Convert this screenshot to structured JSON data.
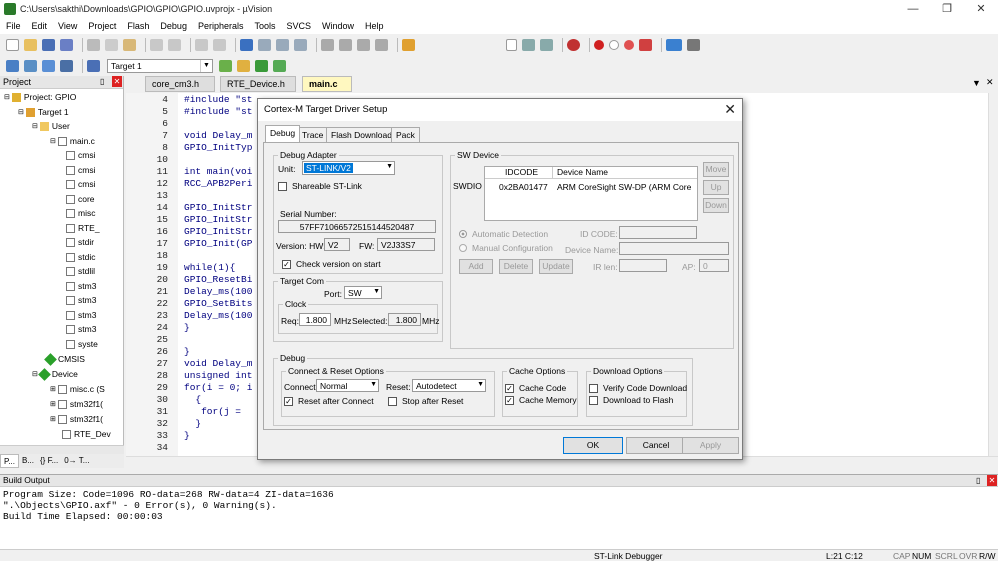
{
  "window": {
    "title": "C:\\Users\\sakthi\\Downloads\\GPIO\\GPIO\\GPIO.uvprojx - µVision",
    "minimize": "—",
    "restore": "❐",
    "close": "✕"
  },
  "menu": [
    "File",
    "Edit",
    "View",
    "Project",
    "Flash",
    "Debug",
    "Peripherals",
    "Tools",
    "SVCS",
    "Window",
    "Help"
  ],
  "build_toolbar": {
    "target": "Target 1"
  },
  "project_pane": {
    "title": "Project",
    "items": [
      "Project: GPIO",
      "Target 1",
      "User",
      "main.c",
      "cmsi",
      "cmsi",
      "cmsi",
      "core",
      "misc",
      "RTE_",
      "stdir",
      "stdic",
      "stdlil",
      "stm3",
      "stm3",
      "stm3",
      "stm3",
      "syste",
      "CMSIS",
      "Device",
      "misc.c (S",
      "stm32f1(",
      "stm32f1(",
      "RTE_Dev"
    ],
    "bottom_tabs": [
      "P...",
      "B...",
      "{} F...",
      "0→ T..."
    ]
  },
  "editor": {
    "tabs": [
      "core_cm3.h",
      "RTE_Device.h",
      "main.c"
    ],
    "lines": [
      {
        "n": "4",
        "t": "#include \"st"
      },
      {
        "n": "5",
        "t": "#include \"st"
      },
      {
        "n": "6",
        "t": ""
      },
      {
        "n": "7",
        "t": "void Delay_m"
      },
      {
        "n": "8",
        "t": "GPIO_InitTyp"
      },
      {
        "n": "10",
        "t": ""
      },
      {
        "n": "11",
        "t": "int main(voi"
      },
      {
        "n": "12",
        "t": "RCC_APB2Peri"
      },
      {
        "n": "13",
        "t": ""
      },
      {
        "n": "14",
        "t": "GPIO_InitStr"
      },
      {
        "n": "15",
        "t": "GPIO_InitStr"
      },
      {
        "n": "16",
        "t": "GPIO_InitStr"
      },
      {
        "n": "17",
        "t": "GPIO_Init(GP"
      },
      {
        "n": "18",
        "t": ""
      },
      {
        "n": "19",
        "t": "while(1){"
      },
      {
        "n": "20",
        "t": "GPIO_ResetBi"
      },
      {
        "n": "21",
        "t": "Delay_ms(100"
      },
      {
        "n": "22",
        "t": "GPIO_SetBits"
      },
      {
        "n": "23",
        "t": "Delay_ms(100"
      },
      {
        "n": "24",
        "t": "}"
      },
      {
        "n": "25",
        "t": ""
      },
      {
        "n": "26",
        "t": "}"
      },
      {
        "n": "27",
        "t": "void Delay_m"
      },
      {
        "n": "28",
        "t": "unsigned int"
      },
      {
        "n": "29",
        "t": "for(i = 0; i"
      },
      {
        "n": "30",
        "t": "  {"
      },
      {
        "n": "31",
        "t": "   for(j ="
      },
      {
        "n": "32",
        "t": "  }"
      },
      {
        "n": "33",
        "t": "}"
      },
      {
        "n": "34",
        "t": ""
      }
    ]
  },
  "dialog": {
    "title": "Cortex-M Target Driver Setup",
    "tabs": [
      "Debug",
      "Trace",
      "Flash Download",
      "Pack"
    ],
    "debug_adapter": {
      "label": "Debug Adapter",
      "unit_label": "Unit:",
      "unit_value": "ST-LINK/V2",
      "shareable": "Shareable ST-Link",
      "serial_label": "Serial Number:",
      "serial": "57FF71066572515144520487",
      "hw_label": "Version: HW:",
      "hw": "V2",
      "fw_label": "FW:",
      "fw": "V2J33S7",
      "check_version": "Check version on start"
    },
    "target_com": {
      "label": "Target Com",
      "port_label": "Port:",
      "port": "SW",
      "clock_label": "Clock",
      "req_label": "Req:",
      "req": "1.800",
      "mhz": "MHz",
      "sel_label": "Selected:",
      "sel": "1.800",
      "mhz2": "MHz"
    },
    "sw_device": {
      "label": "SW Device",
      "col1": "IDCODE",
      "col2": "Device Name",
      "row_label": "SWDIO",
      "idcode": "0x2BA01477",
      "device": "ARM CoreSight SW-DP (ARM Core",
      "move": "Move",
      "up": "Up",
      "down": "Down",
      "auto": "Automatic Detection",
      "manual": "Manual Configuration",
      "id_code": "ID CODE:",
      "dev_name": "Device Name:",
      "ir_len": "IR len:",
      "ap": "AP:",
      "ap_value": "0",
      "add": "Add",
      "delete": "Delete",
      "update": "Update"
    },
    "debug": {
      "label": "Debug",
      "connect_label": "Connect & Reset Options",
      "connect": "Connect:",
      "connect_value": "Normal",
      "reset": "Reset:",
      "reset_value": "Autodetect",
      "reset_after": "Reset after Connect",
      "stop_after": "Stop after Reset",
      "cache_label": "Cache Options",
      "cache_code": "Cache Code",
      "cache_memory": "Cache Memory",
      "dl_label": "Download Options",
      "verify": "Verify Code Download",
      "dl_flash": "Download to Flash"
    },
    "ok": "OK",
    "cancel": "Cancel",
    "apply": "Apply"
  },
  "build_output": {
    "title": "Build Output",
    "lines": [
      "Program Size: Code=1096 RO-data=268 RW-data=4 ZI-data=1636",
      "\".\\Objects\\GPIO.axf\" - 0 Error(s), 0 Warning(s).",
      "Build Time Elapsed:  00:00:03"
    ]
  },
  "status": {
    "debugger": "ST-Link Debugger",
    "pos": "L:21 C:12",
    "cap": "CAP",
    "num": "NUM",
    "scrl": "SCRL",
    "ovr": "OVR",
    "rw": "R/W"
  }
}
